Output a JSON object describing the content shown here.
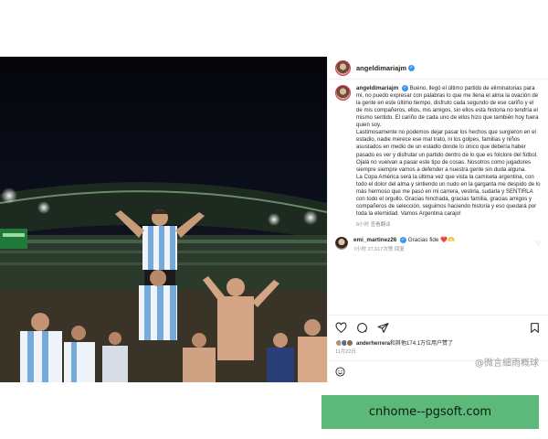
{
  "post": {
    "username": "angeldimariajm",
    "verified_glyph": "✓",
    "caption": "Bueno, llegó el último partido de eliminatorias para mi, no puedo expresar con palabras lo que me llena el alma la ovación de la gente en este último tiempo, disfruto cada segundo de ese cariño y el de mis compañeros, ellos, mis amigos, sin ellos esta historia no tendría el mismo sentido. El cariño de cada uno de ellos hizo que también hoy fuera quien soy.\nLastimosamente no podemos dejar pasar los hechos que surgieron en el estadio, nadie merece ese mal trato, ni los golpes, familias y niños asustados en medio de un estadio donde lo único que debería haber pasado es ver y disfrutar un partido dentro de lo que es folclore del fútbol. Ojalá no vuelvan a pasar este tipo de cosas. Nosotros como jugadores siempre siempre vamos a defender a nuestra gente sin duda alguna.\nLa Copa América será la última vez que vista la camiseta argentina, con todo el dolor del alma y sintiendo un nudo en la garganta me despido de lo más hermoso que me pasó en mi carrera, vestirla, sudarla y SENTIRLA con todo el orgullo. Gracias hinchada, gracias familia, gracias amigos y compañeros de selección, seguimos haciendo historia y eso quedará por toda la eternidad. Vamos Argentina carajo!",
    "meta": "8小时  查看翻译"
  },
  "comment": {
    "username": "emi_martinez26",
    "verified_glyph": "✓",
    "text": "Gracias fide ❤️🫶",
    "meta": "7小时  27,617次赞  回复",
    "heart_glyph": "♡"
  },
  "actions": {
    "like_icon": "heart-icon",
    "comment_icon": "comment-icon",
    "share_icon": "share-icon",
    "save_icon": "bookmark-icon"
  },
  "likes": {
    "user": "anderherrera",
    "text": "和其他174.1万位用户赞了"
  },
  "date": "11月22日",
  "watermark": "@微言細雨概球",
  "banner": {
    "text": "cnhome--pgsoft.com",
    "color": "#5cb97a"
  },
  "colors": {
    "verified": "#3897f0",
    "story_ring": "#e1306c",
    "photo_bg": "#05060a",
    "shirt_stripe": "#75aadb"
  }
}
